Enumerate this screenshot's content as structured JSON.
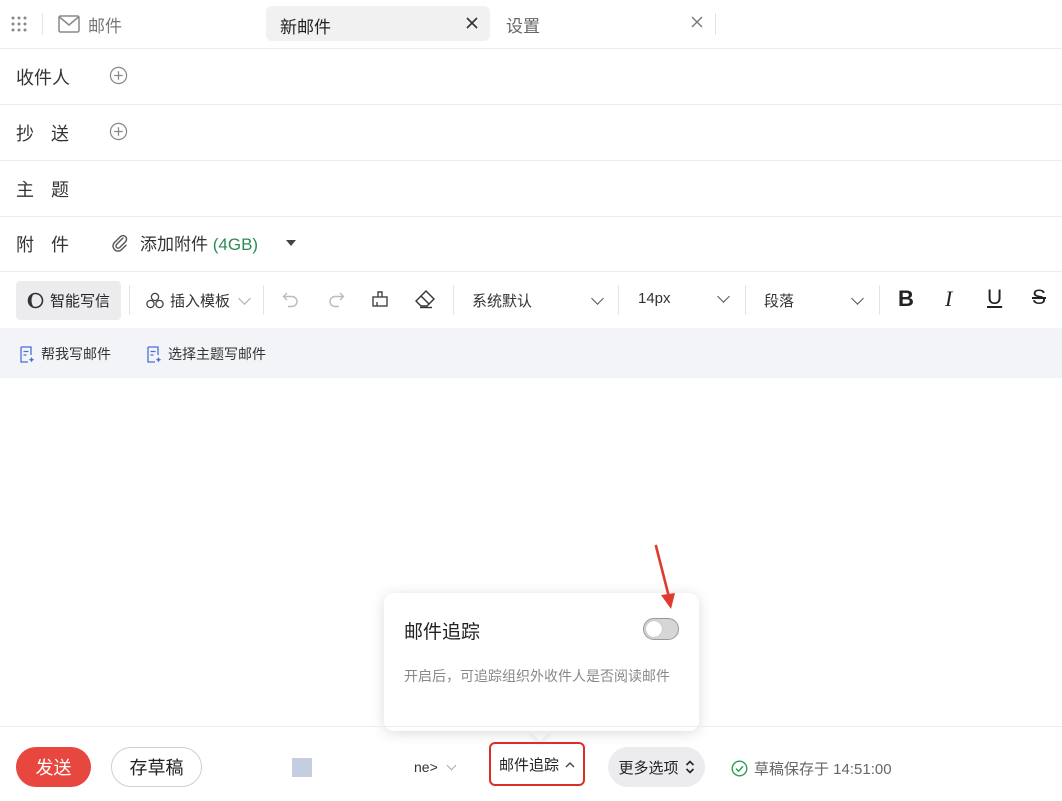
{
  "tabs": {
    "mail_label": "邮件",
    "new_mail_label": "新邮件",
    "settings_label": "设置"
  },
  "fields": {
    "to_label": "收件人",
    "cc_label": "抄 送",
    "subject_label": "主 题",
    "attach_label": "附 件",
    "add_attachment": "添加附件",
    "attachment_limit": "(4GB)"
  },
  "toolbar": {
    "ai_write": "智能写信",
    "insert_template": "插入模板",
    "font_family": "系统默认",
    "font_size": "14px",
    "paragraph": "段落",
    "bold": "B",
    "italic": "I",
    "underline": "U",
    "strike": "S"
  },
  "suggestions": {
    "help_write": "帮我写邮件",
    "topic_write": "选择主题写邮件"
  },
  "popover": {
    "title": "邮件追踪",
    "description": "开启后，可追踪组织外收件人是否阅读邮件",
    "toggle_on": false
  },
  "footer": {
    "send": "发送",
    "save_draft": "存草稿",
    "ne_text": "ne>",
    "track": "邮件追踪",
    "more_options": "更多选项",
    "saved_status": "草稿保存于 14:51:00"
  },
  "colors": {
    "send_bg": "#e8473f",
    "highlight_border": "#d93025",
    "attach_size": "#2e8b57",
    "saved_icon": "#2e9e57"
  }
}
